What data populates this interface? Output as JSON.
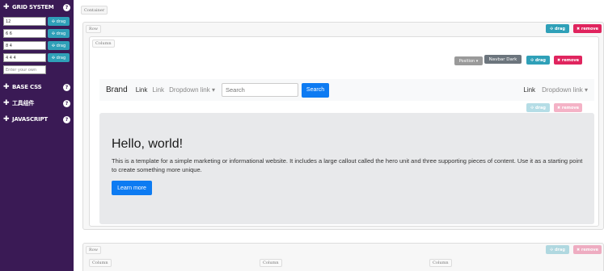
{
  "sidebar": {
    "sections": [
      {
        "label": "GRID SYSTEM",
        "icon": "plus-icon",
        "help": "?"
      },
      {
        "label": "BASE CSS",
        "icon": "plus-icon",
        "help": "?"
      },
      {
        "label": "工具组件",
        "icon": "plus-icon",
        "help": "?"
      },
      {
        "label": "JAVASCRIPT",
        "icon": "plus-icon",
        "help": "?"
      }
    ],
    "grid_options": [
      {
        "value": "12",
        "drag": "✣ drag"
      },
      {
        "value": "6 6",
        "drag": "✣ drag"
      },
      {
        "value": "8 4",
        "drag": "✣ drag"
      },
      {
        "value": "4 4 4",
        "drag": "✣ drag"
      }
    ],
    "custom_placeholder": "Enter your own"
  },
  "canvas": {
    "container_label": "Container",
    "row1": {
      "label": "Row",
      "drag": "✣ drag",
      "remove": "✖ remove",
      "column_label": "Column",
      "position_btn": "Position ▾",
      "navbar_dark_btn": "Navbar Dark",
      "inner_drag": "✣ drag",
      "inner_remove": "✖ remove",
      "jumbo_drag": "✣ drag",
      "jumbo_remove": "✖ remove"
    },
    "row2": {
      "label": "Row",
      "drag": "✣ drag",
      "remove": "✖ remove",
      "columns": [
        "Column",
        "Column",
        "Column"
      ]
    }
  },
  "navbar": {
    "brand": "Brand",
    "link1": "Link",
    "link2": "Link",
    "dropdown": "Dropdown link ▾",
    "search_placeholder": "Search",
    "search_button": "Search",
    "right_link": "Link",
    "right_dropdown": "Dropdown link ▾"
  },
  "jumbotron": {
    "heading": "Hello, world!",
    "text": "This is a template for a simple marketing or informational website. It includes a large callout called the hero unit and three supporting pieces of content. Use it as a starting point to create something more unique.",
    "button": "Learn more"
  },
  "colors": {
    "sidebar_bg": "#3a1a55",
    "drag": "#2fa0b8",
    "remove": "#e0245e",
    "primary": "#0d7bf2"
  }
}
